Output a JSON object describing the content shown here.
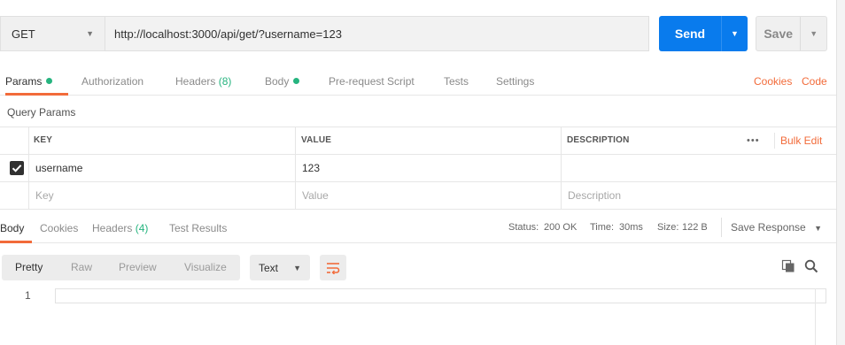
{
  "request": {
    "method": "GET",
    "url": "http://localhost:3000/api/get/?username=123",
    "send_label": "Send",
    "save_label": "Save"
  },
  "request_tabs": {
    "params": "Params",
    "authorization": "Authorization",
    "headers": "Headers",
    "headers_count": "(8)",
    "body": "Body",
    "pre_request": "Pre-request Script",
    "tests": "Tests",
    "settings": "Settings",
    "cookies": "Cookies",
    "code": "Code"
  },
  "query_params": {
    "title": "Query Params",
    "columns": [
      "KEY",
      "VALUE",
      "DESCRIPTION"
    ],
    "bulk_edit": "Bulk Edit",
    "more": "•••",
    "rows": [
      {
        "checked": true,
        "key": "username",
        "value": "123",
        "description": ""
      }
    ],
    "placeholder": {
      "key": "Key",
      "value": "Value",
      "description": "Description"
    }
  },
  "response_tabs": {
    "body": "Body",
    "cookies": "Cookies",
    "headers": "Headers",
    "headers_count": "(4)",
    "test_results": "Test Results"
  },
  "response_status": {
    "status_label": "Status:",
    "status_value": "200 OK",
    "time_label": "Time:",
    "time_value": "30ms",
    "size_label": "Size:",
    "size_value": "122 B",
    "save_response": "Save Response"
  },
  "response_view": {
    "modes": [
      "Pretty",
      "Raw",
      "Preview",
      "Visualize"
    ],
    "active_mode": "Pretty",
    "format": "Text",
    "line_number": "1"
  },
  "icons": {
    "method_caret": "chevron-down-icon",
    "send_caret": "chevron-down-icon",
    "save_caret": "chevron-down-icon",
    "wrap": "wrap-lines-icon",
    "copy": "copy-icon",
    "search": "search-icon"
  },
  "colors": {
    "accent": "#f26b3a",
    "send": "#097bed",
    "success": "#26b47f"
  }
}
